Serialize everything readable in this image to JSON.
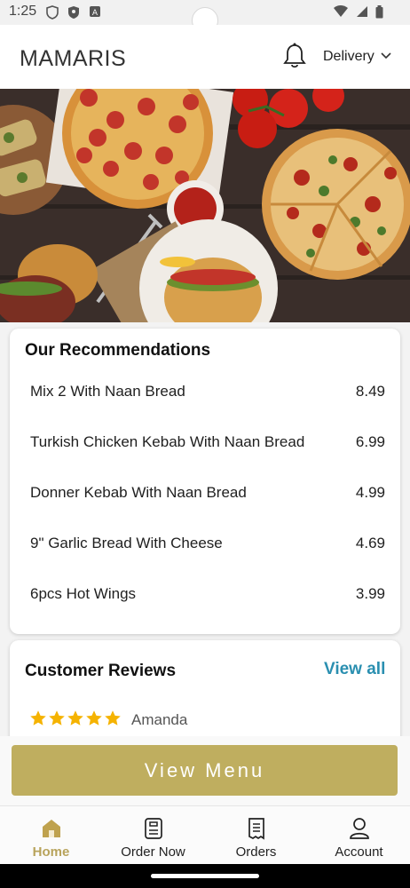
{
  "status": {
    "time": "1:25"
  },
  "header": {
    "brand": "MAMARIS",
    "delivery_label": "Delivery"
  },
  "recommendations": {
    "title": "Our Recommendations",
    "items": [
      {
        "name": "Mix 2 With Naan Bread",
        "price": "8.49"
      },
      {
        "name": "Turkish Chicken Kebab With Naan Bread",
        "price": "6.99"
      },
      {
        "name": "Donner Kebab With Naan Bread",
        "price": "4.99"
      },
      {
        "name": "9\" Garlic Bread With Cheese",
        "price": "4.69"
      },
      {
        "name": "6pcs Hot Wings",
        "price": "3.99"
      }
    ]
  },
  "reviews": {
    "title": "Customer Reviews",
    "view_all": "View all",
    "first": {
      "name": "Amanda",
      "rating": 5
    }
  },
  "cta": {
    "view_menu": "View Menu"
  },
  "nav": {
    "home": "Home",
    "order_now": "Order Now",
    "orders": "Orders",
    "account": "Account"
  },
  "colors": {
    "accent": "#bfae5f",
    "link": "#2a8fb0",
    "star": "#f5b301",
    "active_nav": "#b8a35b"
  }
}
